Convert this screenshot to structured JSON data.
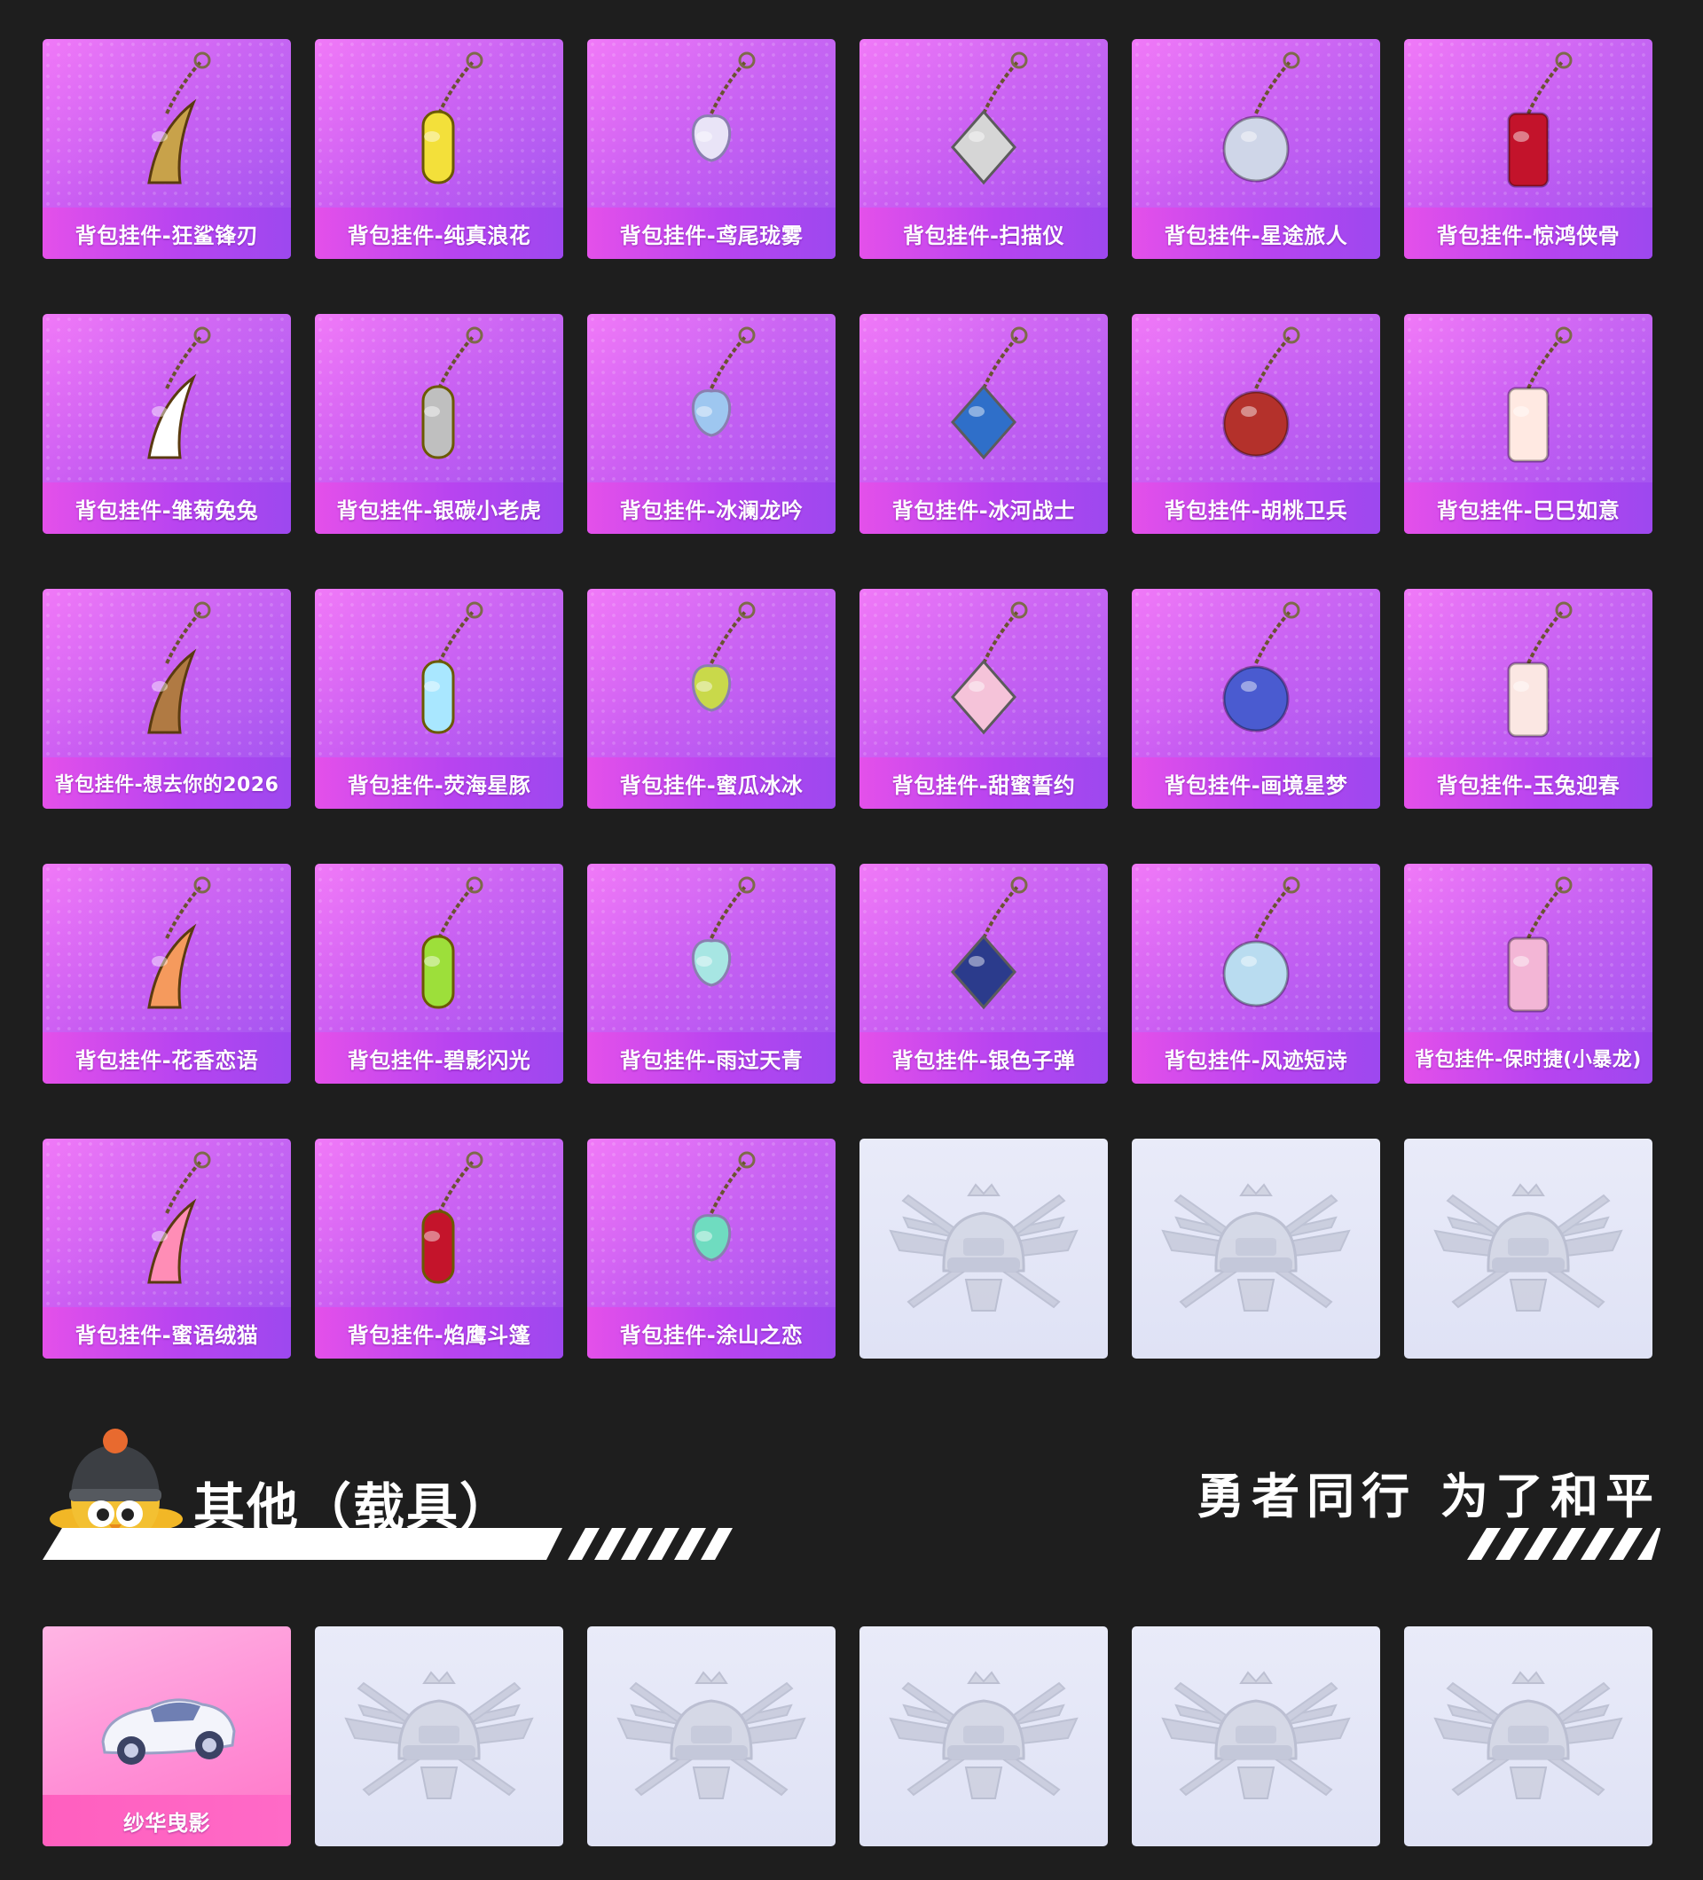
{
  "items": [
    {
      "label": "背包挂件-狂鲨锋刃",
      "icon": "shark-blade-charm-icon",
      "color": "#c8a24a"
    },
    {
      "label": "背包挂件-纯真浪花",
      "icon": "bottle-opener-charm-icon",
      "color": "#f3e03a"
    },
    {
      "label": "背包挂件-鸢尾珑雾",
      "icon": "butterfly-charm-icon",
      "color": "#e9e4f7"
    },
    {
      "label": "背包挂件-扫描仪",
      "icon": "scanner-charm-icon",
      "color": "#d6d6d6"
    },
    {
      "label": "背包挂件-星途旅人",
      "icon": "space-shuttle-charm-icon",
      "color": "#cfd6e8"
    },
    {
      "label": "背包挂件-惊鸿侠骨",
      "icon": "tassel-ring-charm-icon",
      "color": "#c3132b"
    },
    {
      "label": "背包挂件-雏菊兔兔",
      "icon": "daisy-bunny-charm-icon",
      "color": "#ffffff"
    },
    {
      "label": "背包挂件-银碳小老虎",
      "icon": "silver-tiger-charm-icon",
      "color": "#bfbfbf"
    },
    {
      "label": "背包挂件-冰澜龙吟",
      "icon": "ice-dragon-charm-icon",
      "color": "#9ec7f0"
    },
    {
      "label": "背包挂件-冰河战士",
      "icon": "glacier-robot-charm-icon",
      "color": "#2f6fc9"
    },
    {
      "label": "背包挂件-胡桃卫兵",
      "icon": "nutcracker-charm-icon",
      "color": "#b4312b"
    },
    {
      "label": "背包挂件-巳巳如意",
      "icon": "snake-charm-icon",
      "color": "#ffe9e2"
    },
    {
      "label": "背包挂件-想去你的2026",
      "icon": "wooden-plaque-charm-icon",
      "color": "#b07a43"
    },
    {
      "label": "背包挂件-荧海星豚",
      "icon": "bubble-tea-charm-icon",
      "color": "#a9e7ff"
    },
    {
      "label": "背包挂件-蜜瓜冰冰",
      "icon": "melon-popsicle-charm-icon",
      "color": "#c9d94a"
    },
    {
      "label": "背包挂件-甜蜜誓约",
      "icon": "pink-bunny-charm-icon",
      "color": "#f5c3d9"
    },
    {
      "label": "背包挂件-画境星梦",
      "icon": "star-dream-charm-icon",
      "color": "#4a5bd0"
    },
    {
      "label": "背包挂件-玉兔迎春",
      "icon": "jade-rabbit-charm-icon",
      "color": "#fbe7e3"
    },
    {
      "label": "背包挂件-花香恋语",
      "icon": "flower-amulet-charm-icon",
      "color": "#f59a5d"
    },
    {
      "label": "背包挂件-碧影闪光",
      "icon": "game-console-charm-icon",
      "color": "#9ddf3a"
    },
    {
      "label": "背包挂件-雨过天青",
      "icon": "celadon-pendant-charm-icon",
      "color": "#a7e6e3"
    },
    {
      "label": "背包挂件-银色子弹",
      "icon": "silver-bullet-charm-icon",
      "color": "#2b3b8c"
    },
    {
      "label": "背包挂件-风迹短诗",
      "icon": "poem-book-charm-icon",
      "color": "#b9dcf0"
    },
    {
      "label": "背包挂件-保时捷(小暴龙)",
      "icon": "porsche-guitar-charm-icon",
      "color": "#f3b6d6"
    },
    {
      "label": "背包挂件-蜜语绒猫",
      "icon": "heart-charm-icon",
      "color": "#ff8db6"
    },
    {
      "label": "背包挂件-焰鹰斗篷",
      "icon": "knot-tassel-charm-icon",
      "color": "#c4142b"
    },
    {
      "label": "背包挂件-涂山之恋",
      "icon": "fox-tail-charm-icon",
      "color": "#6fdcc0"
    }
  ],
  "placeholders_after_items": 3,
  "section": {
    "title": "其他（载具）",
    "slogan": "勇者同行 为了和平",
    "mascot_icon": "chicken-helmet-mascot-icon"
  },
  "vehicles": [
    {
      "label": "纱华曳影",
      "icon": "white-sports-car-icon"
    }
  ],
  "vehicle_placeholders": 5,
  "placeholder_icon": "pubg-helmet-emblem-icon",
  "colors": {
    "background": "#1e1e1e",
    "card_gradient_start": "#f06ef7",
    "card_gradient_end": "#9b52f0",
    "vehicle_card": "#ff8fd6",
    "placeholder_card": "#e5e8f7"
  }
}
